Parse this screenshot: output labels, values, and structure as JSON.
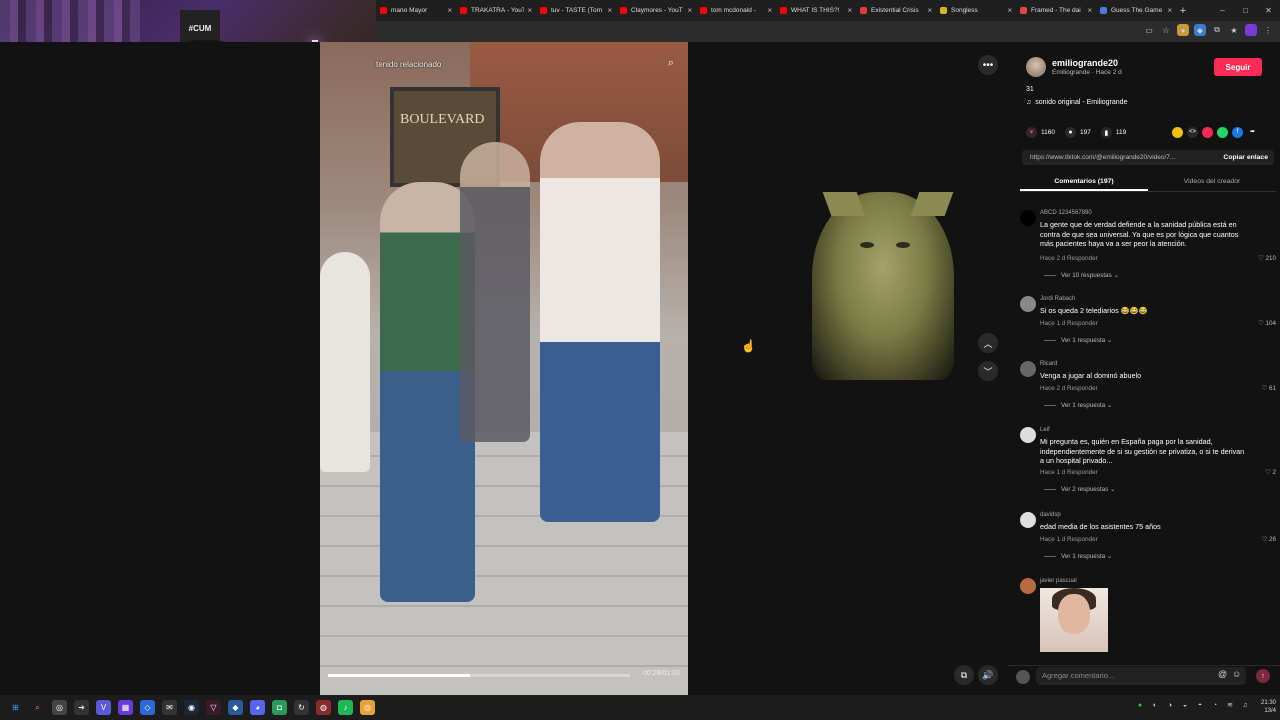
{
  "browser": {
    "tabs": [
      {
        "title": "mano Mayor",
        "color": "#ff0000"
      },
      {
        "title": "TRAKATRÁ - YouT",
        "color": "#ff0000"
      },
      {
        "title": "tuv - TASTE (Tom",
        "color": "#ff0000"
      },
      {
        "title": "Claymores - YouT",
        "color": "#ff0000"
      },
      {
        "title": "tom mcdonald -",
        "color": "#ff0000"
      },
      {
        "title": "WHAT IS THIS?!",
        "color": "#ff0000"
      },
      {
        "title": "Existential Crisis",
        "color": "#e33b3b"
      },
      {
        "title": "Songless",
        "color": "#d6b52a"
      },
      {
        "title": "Framed - The dai",
        "color": "#e04848"
      },
      {
        "title": "Guess The Game",
        "color": "#4a7bd8"
      }
    ],
    "new_tab": "+",
    "window_controls": [
      "–",
      "□",
      "✕"
    ]
  },
  "webcam": {
    "shirt_text": "#CUM"
  },
  "video": {
    "related_label": "tenido relacionado",
    "poster_text": "BOULEVARD",
    "time": "00:29/01:02",
    "progress": 0.47
  },
  "post": {
    "username": "emiliogrande20",
    "subtitle": "Emiliogrande · Hace 2 d",
    "follow_label": "Seguir",
    "caption": "31",
    "sound": "sonido original - Emiliogrande",
    "likes": "1160",
    "comments": "197",
    "saves": "119",
    "url": "https://www.tiktok.com/@emiliogrande20/video/7...",
    "copy_label": "Copiar enlace"
  },
  "tabs": {
    "comments": "Comentarios (197)",
    "creator_videos": "Videos del creador"
  },
  "comments": [
    {
      "user": "ABCD 1234567890",
      "text": "La gente que de verdad defiende a la sanidad pública está en contra de que sea universal. Ya que es por lógica que cuantos más pacientes haya va a ser peor la atención.",
      "meta": "Hace 2 d   Responder",
      "likes": "210",
      "replies": "Ver 10 respuestas ⌄"
    },
    {
      "user": "Jordi Rabach",
      "text": "Si os queda 2 telediarios 😂😂😂",
      "meta": "Hace 1 d   Responder",
      "likes": "104",
      "replies": "Ver 1 respuesta ⌄"
    },
    {
      "user": "Ricard",
      "text": "Venga a jugar al dominó abuelo",
      "meta": "Hace 2 d   Responder",
      "likes": "61",
      "replies": "Ver 1 respuesta ⌄"
    },
    {
      "user": "Leif",
      "text": "Mi pregunta es, quién en España paga por la sanidad, independientemente de si su gestión se privatiza, o si te derivan a un hospital privado...",
      "meta": "Hace 1 d   Responder",
      "likes": "2",
      "replies": "Ver 2 respuestas ⌄"
    },
    {
      "user": "davidsp",
      "text": "edad media de los asistentes 75 años",
      "meta": "Hace 1 d   Responder",
      "likes": "26",
      "replies": "Ver 1 respuesta ⌄"
    },
    {
      "user": "javier pascual"
    }
  ],
  "composer": {
    "placeholder": "Agregar comentario..."
  },
  "taskbar": {
    "time": "21:30",
    "date": "13/4"
  }
}
